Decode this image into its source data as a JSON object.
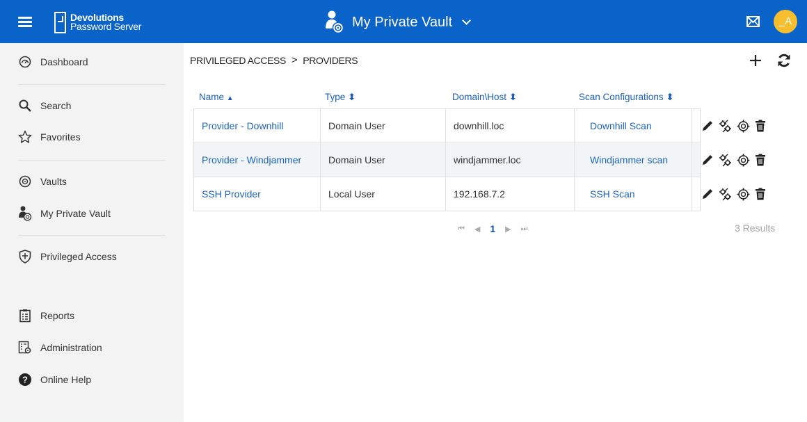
{
  "header": {
    "logo_line1": "Devolutions",
    "logo_line2": "Password Server",
    "vault_title": "My Private Vault",
    "avatar_text": "_A",
    "brand_color": "#0a63c9",
    "avatar_color": "#f7be2f"
  },
  "sidebar": {
    "items": [
      {
        "label": "Dashboard",
        "icon": "dashboard-icon"
      },
      {
        "label": "Search",
        "icon": "search-icon"
      },
      {
        "label": "Favorites",
        "icon": "star-icon"
      },
      {
        "label": "Vaults",
        "icon": "vault-icon"
      },
      {
        "label": "My Private Vault",
        "icon": "private-vault-icon"
      },
      {
        "label": "Privileged Access",
        "icon": "shield-icon"
      },
      {
        "label": "Reports",
        "icon": "reports-icon"
      },
      {
        "label": "Administration",
        "icon": "administration-icon"
      },
      {
        "label": "Online Help",
        "icon": "help-icon"
      }
    ]
  },
  "breadcrumb": {
    "parent": "PRIVILEGED ACCESS",
    "separator": ">",
    "current": "PROVIDERS"
  },
  "table": {
    "columns": [
      "Name",
      "Type",
      "Domain\\Host",
      "Scan Configurations"
    ],
    "sort_indicators": [
      "▲",
      "⬍",
      "⬍",
      "⬍"
    ],
    "rows": [
      {
        "name": "Provider - Downhill",
        "type": "Domain User",
        "host": "downhill.loc",
        "scan": "Downhill Scan"
      },
      {
        "name": "Provider - Windjammer",
        "type": "Domain User",
        "host": "windjammer.loc",
        "scan": "Windjammer scan"
      },
      {
        "name": "SSH Provider",
        "type": "Local User",
        "host": "192.168.7.2",
        "scan": "SSH Scan"
      }
    ],
    "row_actions": [
      "edit-icon",
      "scan-config-icon",
      "target-icon",
      "delete-icon"
    ]
  },
  "pager": {
    "first": "⏮",
    "prev": "◀",
    "current_page": "1",
    "next": "▶",
    "last": "⏭",
    "results": "3 Results"
  }
}
